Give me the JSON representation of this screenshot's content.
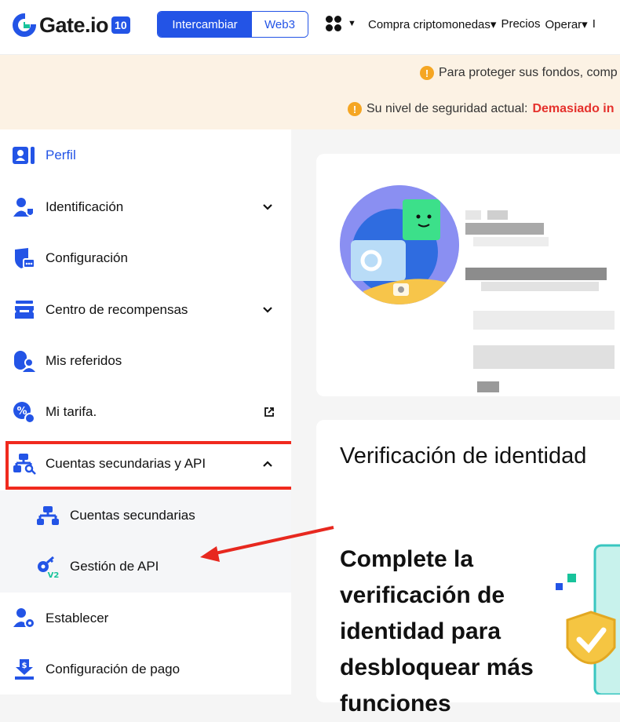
{
  "header": {
    "logo_text": "Gate.io",
    "logo_badge": "10",
    "switch": {
      "active": "Intercambiar",
      "inactive": "Web3"
    },
    "nav": [
      "Compra criptomonedas▾",
      "Precios",
      "Operar▾",
      "I"
    ]
  },
  "alert": {
    "line1": "Para proteger sus fondos, comp",
    "line2_prefix": "Su nivel de seguridad actual:",
    "line2_level": "Demasiado in"
  },
  "sidebar": {
    "items": [
      {
        "label": "Perfil"
      },
      {
        "label": "Identificación"
      },
      {
        "label": "Configuración"
      },
      {
        "label": "Centro de recompensas"
      },
      {
        "label": "Mis referidos"
      },
      {
        "label": "Mi tarifa."
      },
      {
        "label": "Cuentas secundarias y API"
      },
      {
        "label": "Cuentas secundarias"
      },
      {
        "label": "Gestión de API"
      },
      {
        "label": "Establecer"
      },
      {
        "label": "Configuración de pago"
      }
    ]
  },
  "main": {
    "kyc_title": "Verificación de identidad",
    "kyc_body": "Complete la verificación de identidad para desbloquear más funciones"
  },
  "colors": {
    "brand": "#2354e6",
    "accent_green": "#18c39b",
    "danger": "#e5312c",
    "highlight": "#f02a1e"
  }
}
